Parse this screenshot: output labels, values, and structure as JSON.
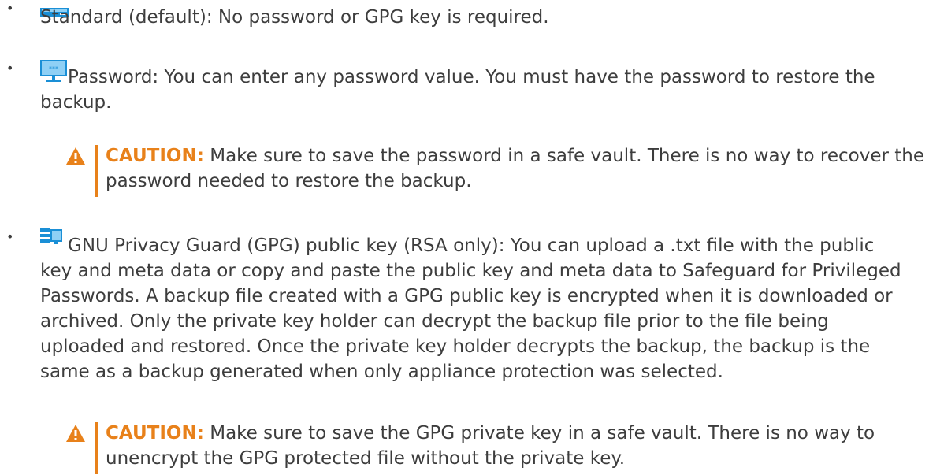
{
  "bullets": {
    "standard": "Standard (default): No password or GPG key is required.",
    "password": "Password: You can enter any password value. You must have the password to restore the backup.",
    "gpg": "GNU Privacy Guard (GPG) public key (RSA only): You can upload a .txt file with the public key and meta data or copy and paste the public key and meta data to Safeguard for Privileged Passwords. A backup file created with a GPG public key is encrypted when it is downloaded or archived. Only the private key holder can decrypt the backup file prior to the file being uploaded and restored. Once the private key holder decrypts the backup, the backup is the same as a backup generated when only appliance protection was selected."
  },
  "cautions": {
    "label": "CAUTION:",
    "password_text": "Make sure to save the password in a safe vault. There is no way to recover the password needed to restore the backup.",
    "gpg_text": "Make sure to save the GPG private key in a safe vault. There is no way to unencrypt the GPG protected file without the private key."
  },
  "icons": {
    "standard": "standard-protection-icon",
    "password": "password-protection-icon",
    "gpg": "gpg-key-protection-icon",
    "caution": "warning-triangle-icon"
  },
  "colors": {
    "text": "#3d3d3d",
    "accent": "#e8811a",
    "icon_blue": "#1a8fd6"
  }
}
